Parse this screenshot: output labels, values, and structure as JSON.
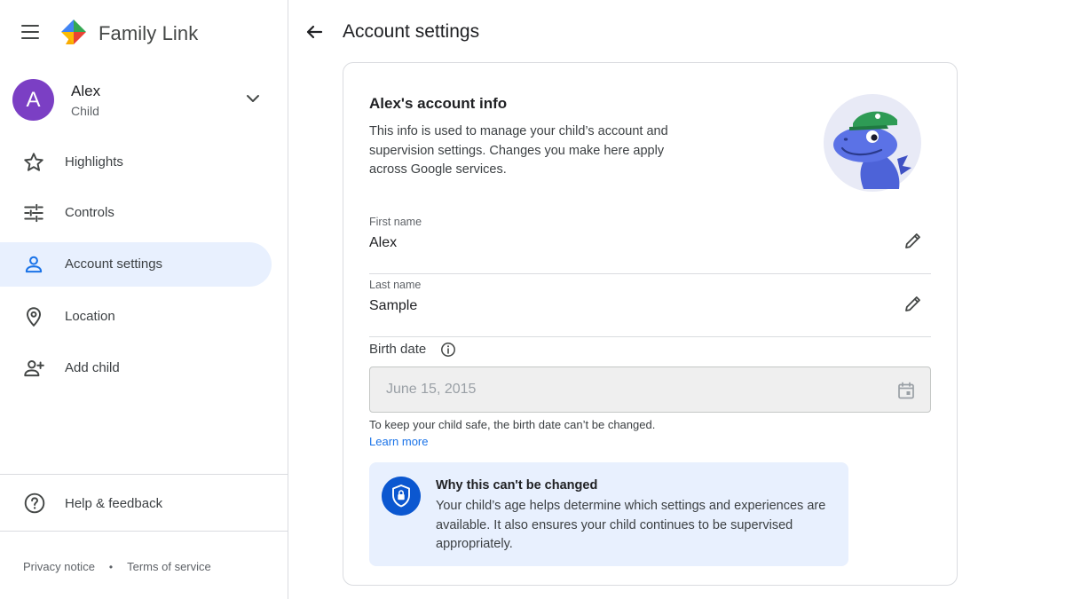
{
  "app": {
    "brand": "Family Link",
    "icons": {
      "menu": "hamburger-menu-icon",
      "logo": "family-link-logo"
    }
  },
  "profile": {
    "initial": "A",
    "name": "Alex",
    "role": "Child",
    "avatar_color": "#7b3fc4"
  },
  "nav": {
    "items": [
      {
        "label": "Highlights",
        "icon": "star-icon"
      },
      {
        "label": "Controls",
        "icon": "sliders-icon"
      },
      {
        "label": "Account settings",
        "icon": "person-icon",
        "active": true
      },
      {
        "label": "Location",
        "icon": "location-pin-icon"
      },
      {
        "label": "Add child",
        "icon": "person-add-icon"
      }
    ],
    "help": {
      "label": "Help & feedback",
      "icon": "help-circle-icon"
    },
    "footer": {
      "privacy": "Privacy notice",
      "separator": "•",
      "terms": "Terms of service"
    }
  },
  "page": {
    "title": "Account settings",
    "back_icon": "arrow-back-icon"
  },
  "card": {
    "title": "Alex's account info",
    "description": "This info is used to manage your child’s account and supervision settings. Changes you make here apply across Google services.",
    "first_name": {
      "label": "First name",
      "value": "Alex"
    },
    "last_name": {
      "label": "Last name",
      "value": "Sample"
    },
    "birth_date": {
      "label": "Birth date",
      "value": "June 15, 2015",
      "hint": "To keep your child safe, the birth date can’t be changed.",
      "learn_more": "Learn more"
    },
    "notice": {
      "title": "Why this can't be changed",
      "body": "Your child’s age helps determine which settings and experiences are available. It also ensures your child continues to be supervised appropriately."
    }
  },
  "colors": {
    "accent": "#1a73e8",
    "active_nav_bg": "#e8f0fe",
    "notice_bg": "#e8f0fe",
    "shield_bg": "#0b57d0"
  }
}
